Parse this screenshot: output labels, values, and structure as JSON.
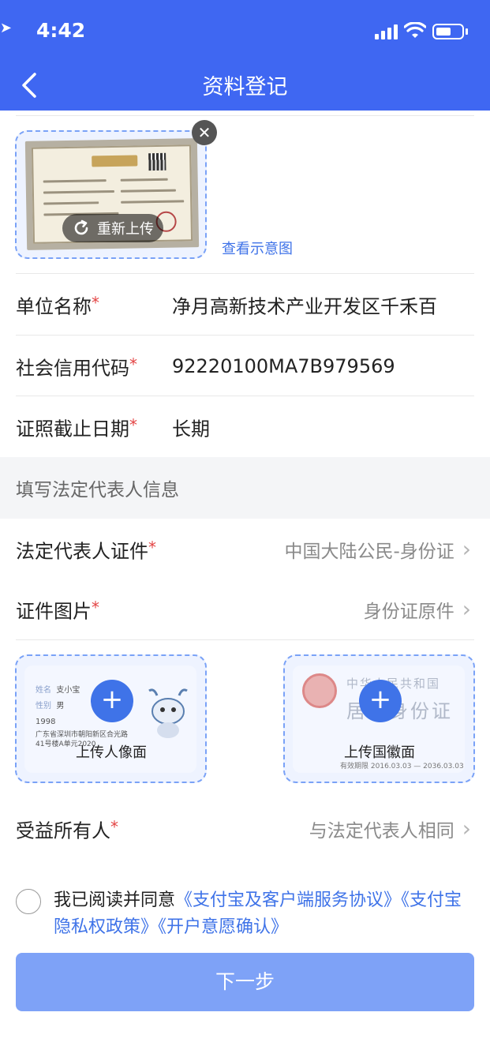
{
  "status_bar": {
    "time": "4:42"
  },
  "header": {
    "title": "资料登记"
  },
  "license": {
    "reupload_label": "重新上传",
    "sample_link": "查看示意图"
  },
  "fields": {
    "unit_name": {
      "label": "单位名称",
      "value": "净月高新技术产业开发区千禾百"
    },
    "credit_code": {
      "label": "社会信用代码",
      "value": "92220100MA7B979569"
    },
    "expiry": {
      "label": "证照截止日期",
      "value": "长期"
    }
  },
  "section": {
    "title": "填写法定代表人信息"
  },
  "legal_rep": {
    "id_type": {
      "label": "法定代表人证件",
      "value": "中国大陆公民-身份证"
    },
    "id_image": {
      "label": "证件图片",
      "value": "身份证原件"
    },
    "portrait_label": "上传人像面",
    "emblem_label": "上传国徽面"
  },
  "portrait_card": {
    "name_key": "姓名",
    "name": "支小宝",
    "gender_key": "性别",
    "gender": "男",
    "year": "1998",
    "address": "广东省深圳市朝阳新区合光路",
    "address2": "41号楼A单元2020"
  },
  "emblem_card": {
    "country": "中华人民共和国",
    "doc": "居民身份证",
    "valid_label": "有效期限",
    "valid": "2016.03.03 — 2036.03.03"
  },
  "beneficiary": {
    "label": "受益所有人",
    "value": "与法定代表人相同"
  },
  "agreement": {
    "prefix": "我已阅读并同意",
    "link1": "《支付宝及客户端服务协议》",
    "link2": "《支付宝隐私权政策》",
    "link3": "《开户意愿确认》"
  },
  "next_button": "下一步",
  "required_mark": "*",
  "colors": {
    "brand": "#3f67f2",
    "link": "#3f73e8",
    "required": "#e34545",
    "button": "#7ea2f7"
  }
}
